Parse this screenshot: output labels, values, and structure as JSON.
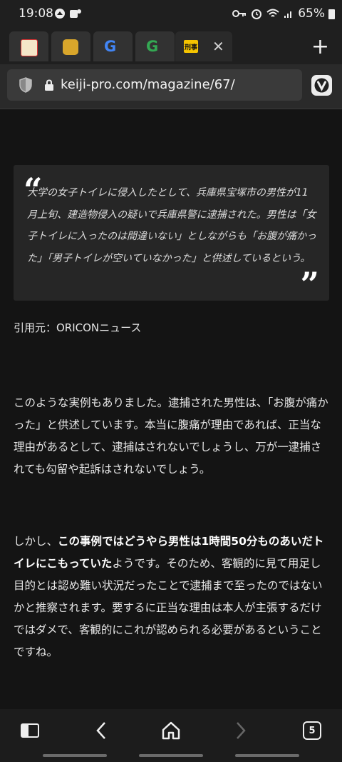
{
  "status": {
    "time": "19:08",
    "battery": "65%"
  },
  "tabs": [
    {
      "favicon": "site-logo-red",
      "active": false
    },
    {
      "favicon": "site-logo-yellow",
      "active": false
    },
    {
      "favicon": "google-icon",
      "text": "G",
      "active": false
    },
    {
      "favicon": "google-icon",
      "text": "G",
      "active": false
    },
    {
      "favicon": "keiji-logo",
      "text": "刑事",
      "active": true
    }
  ],
  "address": {
    "url": "keiji-pro.com/magazine/67/"
  },
  "article": {
    "quote": "大学の女子トイレに侵入したとして、兵庫県宝塚市の男性が11月上旬、建造物侵入の疑いで兵庫県警に逮捕された。男性は「女子トイレに入ったのは間違いない」としながらも「お腹が痛かった」「男子トイレが空いていなかった」と供述しているという。",
    "citation": "引用元：ORICONニュース",
    "para1": "このような実例もありました。逮捕された男性は、「お腹が痛かった」と供述しています。本当に腹痛が理由であれば、正当な理由があるとして、逮捕はされないでしょうし、万が一逮捕されても勾留や起訴はされないでしょう。",
    "para2_pre": "しかし、",
    "para2_bold": "この事例ではどうやら男性は1時間50分ものあいだトイレにこもっていた",
    "para2_post": "ようです。そのため、客観的に見て用足し目的とは認め難い状況だったことで逮捕まで至ったのではないかと推察されます。要するに正当な理由は本人が主張するだけではダメで、客観的にこれが認められる必要があるということですね。"
  },
  "bottom_nav": {
    "tab_count": "5"
  }
}
